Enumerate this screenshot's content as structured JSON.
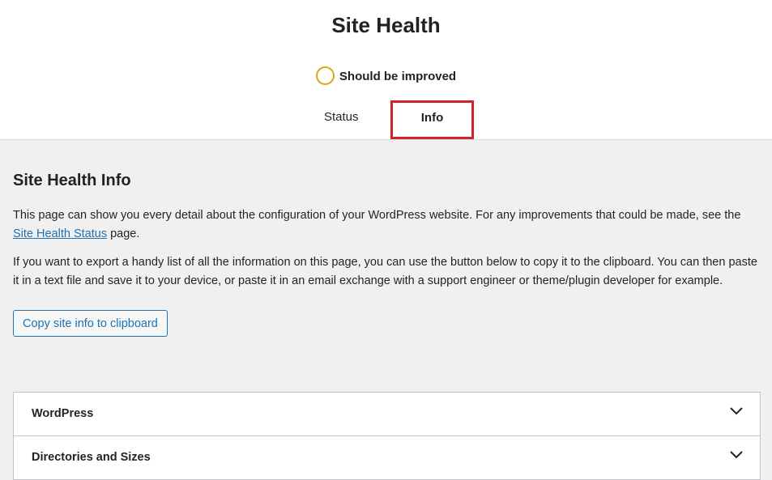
{
  "header": {
    "title": "Site Health",
    "status": "Should be improved",
    "tabs": [
      {
        "label": "Status"
      },
      {
        "label": "Info"
      }
    ]
  },
  "info": {
    "title": "Site Health Info",
    "para1_before": "This page can show you every detail about the configuration of your WordPress website. For any improvements that could be made, see the ",
    "para1_link": "Site Health Status",
    "para1_after": " page.",
    "para2": "If you want to export a handy list of all the information on this page, you can use the button below to copy it to the clipboard. You can then paste it in a text file and save it to your device, or paste it in an email exchange with a support engineer or theme/plugin developer for example.",
    "copy_button": "Copy site info to clipboard"
  },
  "accordion": [
    {
      "label": "WordPress"
    },
    {
      "label": "Directories and Sizes"
    }
  ],
  "colors": {
    "status_ring": "#dba617",
    "highlight_border": "#d0232a",
    "link": "#2271b1"
  },
  "icons": {
    "status": "status-circle-icon",
    "expand": "chevron-down-icon"
  }
}
